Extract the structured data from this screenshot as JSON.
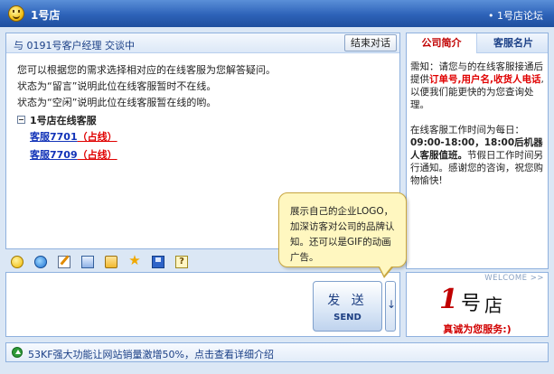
{
  "window": {
    "title": "1号店",
    "forum_link": "• 1号店论坛"
  },
  "chat": {
    "header_text": "与 0191号客户经理 交谈中",
    "end_button": "结束对话",
    "lines": [
      "您可以根据您的需求选择相对应的在线客服为您解答疑问。",
      "状态为“留言”说明此位在线客服暂时不在线。",
      "状态为“空闲”说明此位在线客服暂在线的哟。"
    ],
    "tree_root": "1号店在线客服",
    "agents": [
      {
        "name": "客服7701",
        "status": "（占线）"
      },
      {
        "name": "客服7709",
        "status": "（占线）"
      }
    ]
  },
  "toolbar": {
    "icons": [
      "emoticon-icon",
      "ie-icon",
      "edit-icon",
      "screenshot-icon",
      "folder-icon",
      "star-icon",
      "save-icon",
      "help-icon"
    ],
    "help_glyph": "?"
  },
  "send": {
    "label_cn": "发 送",
    "label_en": "SEND",
    "arrow": "↓"
  },
  "side": {
    "tab_active": "公司简介",
    "tab_inactive": "客服名片",
    "notice_pre": "需知：请您与的在线客服接通后提供",
    "notice_red": "订单号,用户名,收货人电话",
    "notice_post": ",以便我们能更快的为您查询处理。",
    "hours_pre": "在线客服工作时间为每日：",
    "hours_bold": "09:00-18:00，18:00后机器人客服值班。",
    "hours_post": "节假日工作时间另行通知。感谢您的咨询，祝您购物愉快!"
  },
  "welcome": {
    "label": "WELCOME >>",
    "logo_num": "1",
    "logo_hao": "号",
    "logo_dian": "店",
    "slogan": "真诚为您服务:)"
  },
  "callout": {
    "text": "展示自己的企业LOGO，加深访客对公司的品牌认知。还可以是GIF的动画广告。"
  },
  "footer": {
    "text": "53KF强大功能让网站销量激增50%，点击查看详细介绍"
  },
  "colors": {
    "titlebar": "#2d62b8",
    "accent_red": "#e00000",
    "link_blue": "#1233b8"
  }
}
